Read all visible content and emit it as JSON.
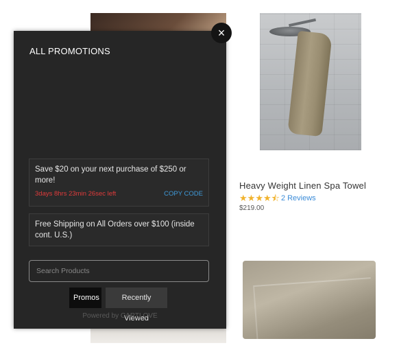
{
  "product": {
    "title": "Heavy Weight Linen Spa Towel",
    "rating": 4.5,
    "stars": [
      "★",
      "★",
      "★",
      "★",
      "⯪"
    ],
    "reviews_label": "2 Reviews",
    "price": "$219.00"
  },
  "modal": {
    "title": "ALL PROMOTIONS",
    "close_icon": "×",
    "promos": [
      {
        "text": "Save $20 on your next purchase of $250 or more!",
        "countdown": "3days 8hrs 23min 26sec left",
        "action": "COPY CODE"
      },
      {
        "text": "Free Shipping on All Orders over $100 (inside cont. U.S.)"
      }
    ],
    "search_placeholder": "Search Products",
    "tabs": [
      {
        "label": "Promos",
        "active": true
      },
      {
        "label": "Recently Viewed",
        "active": false
      }
    ],
    "powered_by": "Powered by CARTLOVE"
  },
  "colors": {
    "modal_bg": "#262626",
    "countdown": "#e03b3b",
    "copy_code": "#3f9ad9",
    "star": "#f1b32e",
    "review_link": "#3a8bd8"
  }
}
